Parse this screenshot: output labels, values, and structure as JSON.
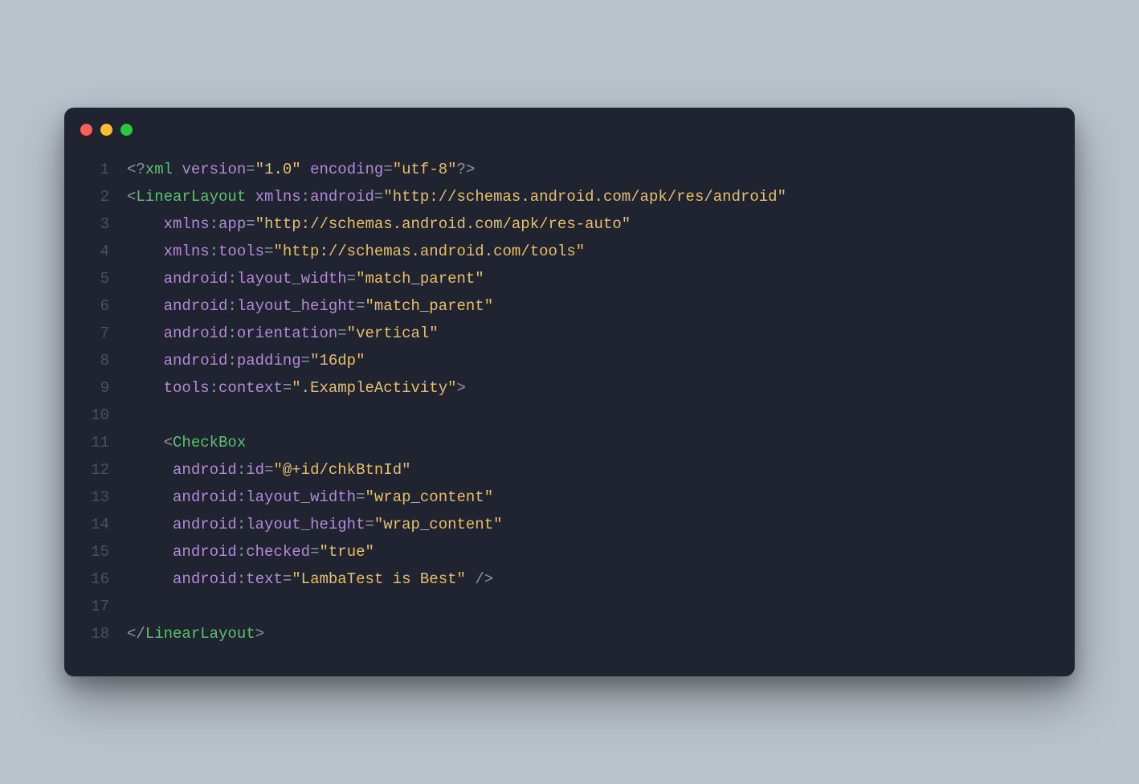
{
  "lines": [
    {
      "n": "1",
      "tokens": [
        {
          "c": "punc",
          "t": "<?"
        },
        {
          "c": "tag",
          "t": "xml"
        },
        {
          "c": "",
          "t": " "
        },
        {
          "c": "ns",
          "t": "version"
        },
        {
          "c": "eq",
          "t": "="
        },
        {
          "c": "str",
          "t": "\"1.0\""
        },
        {
          "c": "",
          "t": " "
        },
        {
          "c": "ns",
          "t": "encoding"
        },
        {
          "c": "eq",
          "t": "="
        },
        {
          "c": "str",
          "t": "\"utf-8\""
        },
        {
          "c": "punc",
          "t": "?>"
        }
      ]
    },
    {
      "n": "2",
      "tokens": [
        {
          "c": "punc",
          "t": "<"
        },
        {
          "c": "tag",
          "t": "LinearLayout"
        },
        {
          "c": "",
          "t": " "
        },
        {
          "c": "ns",
          "t": "xmlns"
        },
        {
          "c": "punc",
          "t": ":"
        },
        {
          "c": "attr",
          "t": "android"
        },
        {
          "c": "eq",
          "t": "="
        },
        {
          "c": "str",
          "t": "\"http://schemas.android.com/apk/res/android\""
        }
      ]
    },
    {
      "n": "3",
      "tokens": [
        {
          "c": "",
          "t": "    "
        },
        {
          "c": "ns",
          "t": "xmlns"
        },
        {
          "c": "punc",
          "t": ":"
        },
        {
          "c": "attr",
          "t": "app"
        },
        {
          "c": "eq",
          "t": "="
        },
        {
          "c": "str",
          "t": "\"http://schemas.android.com/apk/res-auto\""
        }
      ]
    },
    {
      "n": "4",
      "tokens": [
        {
          "c": "",
          "t": "    "
        },
        {
          "c": "ns",
          "t": "xmlns"
        },
        {
          "c": "punc",
          "t": ":"
        },
        {
          "c": "attr",
          "t": "tools"
        },
        {
          "c": "eq",
          "t": "="
        },
        {
          "c": "str",
          "t": "\"http://schemas.android.com/tools\""
        }
      ]
    },
    {
      "n": "5",
      "tokens": [
        {
          "c": "",
          "t": "    "
        },
        {
          "c": "ns",
          "t": "android"
        },
        {
          "c": "punc",
          "t": ":"
        },
        {
          "c": "attr",
          "t": "layout_width"
        },
        {
          "c": "eq",
          "t": "="
        },
        {
          "c": "str",
          "t": "\"match_parent\""
        }
      ]
    },
    {
      "n": "6",
      "tokens": [
        {
          "c": "",
          "t": "    "
        },
        {
          "c": "ns",
          "t": "android"
        },
        {
          "c": "punc",
          "t": ":"
        },
        {
          "c": "attr",
          "t": "layout_height"
        },
        {
          "c": "eq",
          "t": "="
        },
        {
          "c": "str",
          "t": "\"match_parent\""
        }
      ]
    },
    {
      "n": "7",
      "tokens": [
        {
          "c": "",
          "t": "    "
        },
        {
          "c": "ns",
          "t": "android"
        },
        {
          "c": "punc",
          "t": ":"
        },
        {
          "c": "attr",
          "t": "orientation"
        },
        {
          "c": "eq",
          "t": "="
        },
        {
          "c": "str",
          "t": "\"vertical\""
        }
      ]
    },
    {
      "n": "8",
      "tokens": [
        {
          "c": "",
          "t": "    "
        },
        {
          "c": "ns",
          "t": "android"
        },
        {
          "c": "punc",
          "t": ":"
        },
        {
          "c": "attr",
          "t": "padding"
        },
        {
          "c": "eq",
          "t": "="
        },
        {
          "c": "str",
          "t": "\"16dp\""
        }
      ]
    },
    {
      "n": "9",
      "tokens": [
        {
          "c": "",
          "t": "    "
        },
        {
          "c": "ns",
          "t": "tools"
        },
        {
          "c": "punc",
          "t": ":"
        },
        {
          "c": "attr",
          "t": "context"
        },
        {
          "c": "eq",
          "t": "="
        },
        {
          "c": "str",
          "t": "\".ExampleActivity\""
        },
        {
          "c": "punc",
          "t": ">"
        }
      ]
    },
    {
      "n": "10",
      "tokens": []
    },
    {
      "n": "11",
      "tokens": [
        {
          "c": "",
          "t": "    "
        },
        {
          "c": "punc",
          "t": "<"
        },
        {
          "c": "tag",
          "t": "CheckBox"
        }
      ]
    },
    {
      "n": "12",
      "tokens": [
        {
          "c": "",
          "t": "     "
        },
        {
          "c": "ns",
          "t": "android"
        },
        {
          "c": "punc",
          "t": ":"
        },
        {
          "c": "attr",
          "t": "id"
        },
        {
          "c": "eq",
          "t": "="
        },
        {
          "c": "str",
          "t": "\"@+id/chkBtnId\""
        }
      ]
    },
    {
      "n": "13",
      "tokens": [
        {
          "c": "",
          "t": "     "
        },
        {
          "c": "ns",
          "t": "android"
        },
        {
          "c": "punc",
          "t": ":"
        },
        {
          "c": "attr",
          "t": "layout_width"
        },
        {
          "c": "eq",
          "t": "="
        },
        {
          "c": "str",
          "t": "\"wrap_content\""
        }
      ]
    },
    {
      "n": "14",
      "tokens": [
        {
          "c": "",
          "t": "     "
        },
        {
          "c": "ns",
          "t": "android"
        },
        {
          "c": "punc",
          "t": ":"
        },
        {
          "c": "attr",
          "t": "layout_height"
        },
        {
          "c": "eq",
          "t": "="
        },
        {
          "c": "str",
          "t": "\"wrap_content\""
        }
      ]
    },
    {
      "n": "15",
      "tokens": [
        {
          "c": "",
          "t": "     "
        },
        {
          "c": "ns",
          "t": "android"
        },
        {
          "c": "punc",
          "t": ":"
        },
        {
          "c": "attr",
          "t": "checked"
        },
        {
          "c": "eq",
          "t": "="
        },
        {
          "c": "str",
          "t": "\"true\""
        }
      ]
    },
    {
      "n": "16",
      "tokens": [
        {
          "c": "",
          "t": "     "
        },
        {
          "c": "ns",
          "t": "android"
        },
        {
          "c": "punc",
          "t": ":"
        },
        {
          "c": "attr",
          "t": "text"
        },
        {
          "c": "eq",
          "t": "="
        },
        {
          "c": "str",
          "t": "\"LambaTest is Best\""
        },
        {
          "c": "",
          "t": " "
        },
        {
          "c": "punc",
          "t": "/>"
        }
      ]
    },
    {
      "n": "17",
      "tokens": []
    },
    {
      "n": "18",
      "tokens": [
        {
          "c": "punc",
          "t": "</"
        },
        {
          "c": "tag",
          "t": "LinearLayout"
        },
        {
          "c": "punc",
          "t": ">"
        }
      ]
    }
  ]
}
